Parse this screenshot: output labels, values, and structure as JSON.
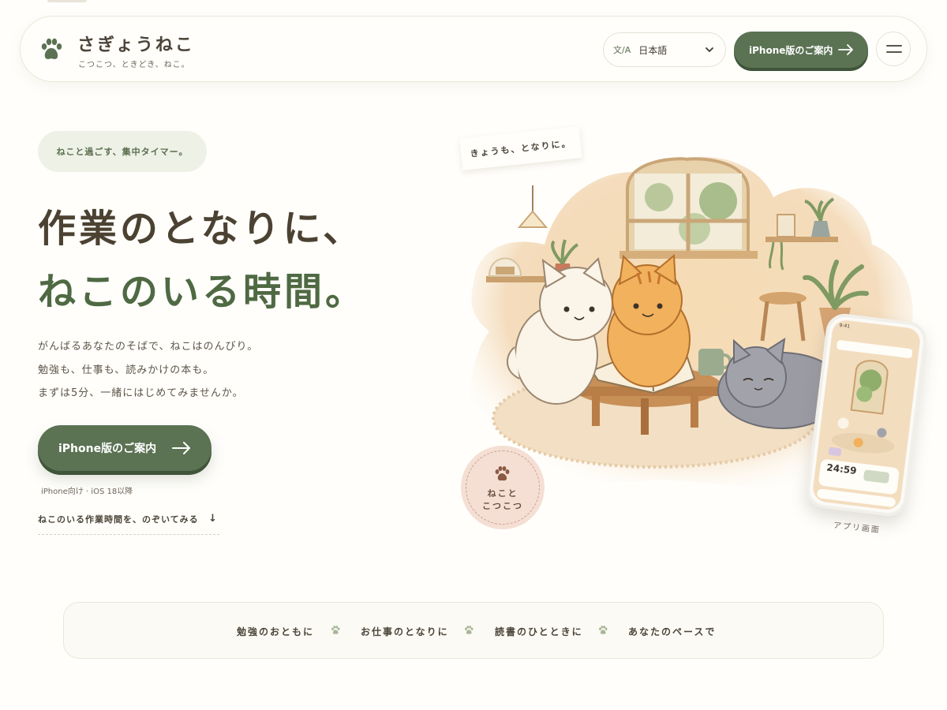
{
  "header": {
    "brand_name": "さぎょうねこ",
    "brand_tagline": "こつこつ、ときどき、ねこ。",
    "language_icon": "文/A",
    "language_value": "日本語",
    "cta_label": "iPhone版のご案内"
  },
  "hero": {
    "badge": "ねこと過ごす、集中タイマー。",
    "headline_line1": "作業のとなりに、",
    "headline_line2": "ねこのいる時間。",
    "description": [
      "がんばるあなたのそばで、ねこはのんびり。",
      "勉強も、仕事も、読みかけの本も。",
      "まずは5分、一緒にはじめてみませんか。"
    ],
    "cta_label": "iPhone版のご案内",
    "cta_note": "iPhone向け · iOS 18以降",
    "peek_link": "ねこのいる作業時間を、のぞいてみる",
    "peek_arrow": "↓"
  },
  "illustration": {
    "sticky_note": "きょうも、となりに。",
    "stamp_line1": "ねこと",
    "stamp_line2": "こつこつ",
    "phone_status": "9:41",
    "phone_timer": "24:59",
    "phone_caption": "アプリ画面"
  },
  "scenes": [
    "勉強のおともに",
    "お仕事のとなりに",
    "読書のひとときに",
    "あなたのペースで"
  ],
  "colors": {
    "accent_green": "#5b7253",
    "headline_green": "#4f6a43",
    "background": "#fffefb",
    "stamp_pink": "#f5dfd4"
  },
  "icons": [
    "paw-icon",
    "language-icon",
    "chevron-down-icon",
    "arrow-right-icon",
    "menu-icon",
    "arrow-down-icon"
  ]
}
